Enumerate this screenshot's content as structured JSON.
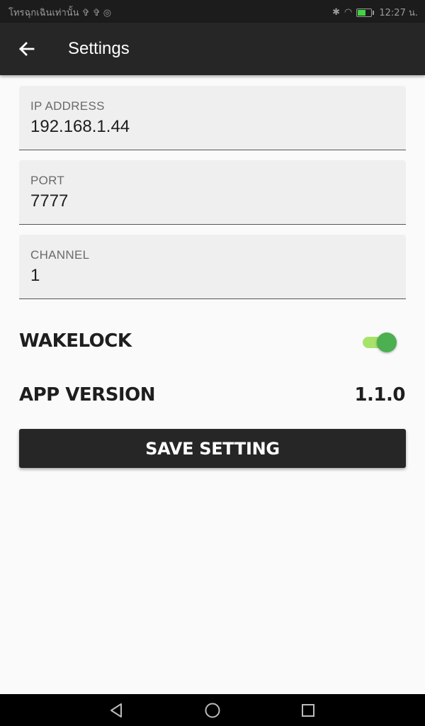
{
  "status_bar": {
    "carrier_text": "โทรฉุกเฉินเท่านั้น ✞ ✞ ◎",
    "time": "12:27 น.",
    "battery_level": 0.6
  },
  "app_bar": {
    "title": "Settings",
    "back_icon": "arrow-left-icon"
  },
  "fields": [
    {
      "label": "IP ADDRESS",
      "value": "192.168.1.44"
    },
    {
      "label": "PORT",
      "value": "7777"
    },
    {
      "label": "CHANNEL",
      "value": "1"
    }
  ],
  "wakelock": {
    "label": "WAKELOCK",
    "enabled": true
  },
  "app_version": {
    "label": "APP VERSION",
    "value": "1.1.0"
  },
  "save_button": {
    "label": "SAVE SETTING"
  },
  "colors": {
    "app_bar": "#262626",
    "switch_thumb": "#4caf50",
    "switch_track": "#a7e36a",
    "background": "#fafafa"
  }
}
